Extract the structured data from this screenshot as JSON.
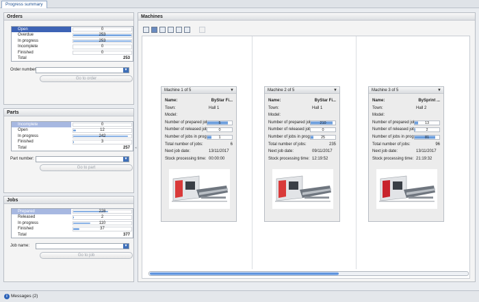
{
  "tab": {
    "label": "Progress summary"
  },
  "orders": {
    "title": "Orders",
    "rows": [
      {
        "label": "Open",
        "value": "0",
        "fill": 0,
        "style": "sel"
      },
      {
        "label": "Overdue",
        "value": "253",
        "fill": 1
      },
      {
        "label": "In progress",
        "value": "253",
        "fill": 1
      },
      {
        "label": "Incomplete",
        "value": "0",
        "fill": 0
      },
      {
        "label": "Finished",
        "value": "0",
        "fill": 0
      }
    ],
    "total_label": "Total",
    "total_value": "253",
    "field_label": "Order number",
    "go_label": "Go to order"
  },
  "parts": {
    "title": "Parts",
    "rows": [
      {
        "label": "Incomplete",
        "value": "0",
        "fill": 0,
        "style": "hl"
      },
      {
        "label": "Open",
        "value": "12",
        "fill": 0.05
      },
      {
        "label": "In progress",
        "value": "242",
        "fill": 0.94
      },
      {
        "label": "Finished",
        "value": "3",
        "fill": 0.01
      }
    ],
    "total_label": "Total",
    "total_value": "257",
    "field_label": "Part number:",
    "go_label": "Go to part"
  },
  "jobs": {
    "title": "Jobs",
    "rows": [
      {
        "label": "Prepared",
        "value": "228",
        "fill": 0.6,
        "style": "hl"
      },
      {
        "label": "Released",
        "value": "2",
        "fill": 0.01
      },
      {
        "label": "In progress",
        "value": "110",
        "fill": 0.29
      },
      {
        "label": "Finished",
        "value": "37",
        "fill": 0.1
      }
    ],
    "total_label": "Total",
    "total_value": "377",
    "field_label": "Job name:",
    "go_label": "Go to job"
  },
  "machines": {
    "title": "Machines",
    "labels": {
      "name": "Name:",
      "town": "Town:",
      "model": "Model:",
      "prepared": "Number of prepared jobs:",
      "released": "Number of released jobs:",
      "in_progress": "Number of jobs in progress:",
      "total": "Total number of jobs:",
      "next_date": "Next job date:",
      "stock": "Stock processing time:"
    },
    "cards": [
      {
        "header": "Machine 1 of 5",
        "name": "ByStar Fi...",
        "town": "Hall 1",
        "model": "",
        "prepared": "5",
        "prepared_fill": 0.83,
        "released": "0",
        "released_fill": 0,
        "in_progress": "1",
        "in_progress_fill": 0.17,
        "total": "6",
        "next_date": "13/11/2017",
        "stock": "00:00:00",
        "machine_color": "#d93a3a"
      },
      {
        "header": "Machine 2 of 5",
        "name": "ByStar Fi...",
        "town": "Hall 1",
        "model": "",
        "prepared": "210",
        "prepared_fill": 0.89,
        "released": "0",
        "released_fill": 0,
        "in_progress": "25",
        "in_progress_fill": 0.11,
        "total": "235",
        "next_date": "09/11/2017",
        "stock": "12:19:52",
        "machine_color": "#d93a3a"
      },
      {
        "header": "Machine 3 of 5",
        "name": "BySprint ...",
        "town": "Hall 2",
        "model": "",
        "prepared": "13",
        "prepared_fill": 0.14,
        "released": "2",
        "released_fill": 0.02,
        "in_progress": "81",
        "in_progress_fill": 0.84,
        "total": "96",
        "next_date": "13/11/2017",
        "stock": "21:19:32",
        "machine_color": "#c8232c"
      }
    ]
  },
  "status": {
    "messages": "Messages (2)"
  },
  "colors": {
    "accent": "#3d63b5",
    "bar": "#4f8bd6",
    "brand_red": "#d93a3a"
  }
}
